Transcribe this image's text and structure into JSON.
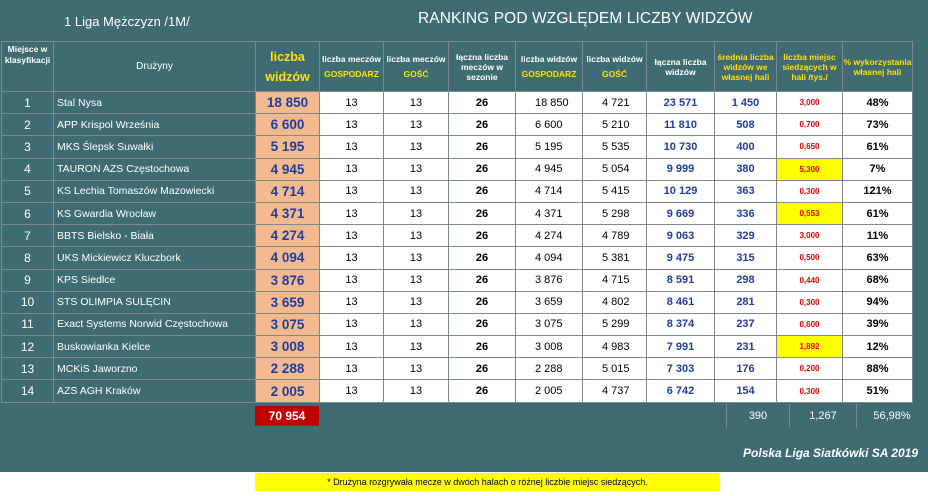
{
  "league": "1 Liga Mężczyzn /1M/",
  "title": "RANKING POD WZGLĘDEM LICZBY WIDZÓW",
  "headers": {
    "place": "Miejsce w klasyfikacji",
    "team": "Drużyny",
    "viewers_1": "liczba",
    "viewers_2": "widzów",
    "home_matches": "liczba meczów",
    "home_sub": "GOSPODARZ",
    "away_matches": "liczba meczów",
    "away_sub": "GOŚĆ",
    "total_matches": "łączna liczba meczów w sezonie",
    "home_viewers": "liczba widzów",
    "home_viewers_sub": "GOSPODARZ",
    "away_viewers": "liczba widzów",
    "away_viewers_sub": "GOŚĆ",
    "total_viewers": "łączna liczba widzów",
    "avg_viewers": "średnia liczba widzów we własnej hali",
    "seats": "liczba miejsc siedzących w hali /tys./",
    "usage": "% wykorzystania własnej hali"
  },
  "rows": [
    {
      "pos": "1",
      "team": "Stal Nysa",
      "viewers": "18 850",
      "hm": "13",
      "am": "13",
      "tm": "26",
      "hv": "18 850",
      "av": "4 721",
      "tv": "23 571",
      "avg": "1 450",
      "seats": "3,000",
      "pct": "48%"
    },
    {
      "pos": "2",
      "team": "APP Krispol Września",
      "viewers": "6 600",
      "hm": "13",
      "am": "13",
      "tm": "26",
      "hv": "6 600",
      "av": "5 210",
      "tv": "11 810",
      "avg": "508",
      "seats": "0,700",
      "pct": "73%"
    },
    {
      "pos": "3",
      "team": "MKS Ślepsk Suwałki",
      "viewers": "5 195",
      "hm": "13",
      "am": "13",
      "tm": "26",
      "hv": "5 195",
      "av": "5 535",
      "tv": "10 730",
      "avg": "400",
      "seats": "0,650",
      "pct": "61%"
    },
    {
      "pos": "4",
      "team": "TAURON AZS Częstochowa",
      "viewers": "4 945",
      "hm": "13",
      "am": "13",
      "tm": "26",
      "hv": "4 945",
      "av": "5 054",
      "tv": "9 999",
      "avg": "380",
      "seats": "5,300",
      "pct": "7%"
    },
    {
      "pos": "5",
      "team": "KS Lechia Tomaszów Mazowiecki",
      "viewers": "4 714",
      "hm": "13",
      "am": "13",
      "tm": "26",
      "hv": "4 714",
      "av": "5 415",
      "tv": "10 129",
      "avg": "363",
      "seats": "0,300",
      "pct": "121%"
    },
    {
      "pos": "6",
      "team": "KS Gwardia Wrocław",
      "viewers": "4 371",
      "hm": "13",
      "am": "13",
      "tm": "26",
      "hv": "4 371",
      "av": "5 298",
      "tv": "9 669",
      "avg": "336",
      "seats": "0,553",
      "pct": "61%"
    },
    {
      "pos": "7",
      "team": "BBTS Bielsko - Biała",
      "viewers": "4 274",
      "hm": "13",
      "am": "13",
      "tm": "26",
      "hv": "4 274",
      "av": "4 789",
      "tv": "9 063",
      "avg": "329",
      "seats": "3,000",
      "pct": "11%"
    },
    {
      "pos": "8",
      "team": "UKS Mickiewicz Kluczbork",
      "viewers": "4 094",
      "hm": "13",
      "am": "13",
      "tm": "26",
      "hv": "4 094",
      "av": "5 381",
      "tv": "9 475",
      "avg": "315",
      "seats": "0,500",
      "pct": "63%"
    },
    {
      "pos": "9",
      "team": "KPS Siedlce",
      "viewers": "3 876",
      "hm": "13",
      "am": "13",
      "tm": "26",
      "hv": "3 876",
      "av": "4 715",
      "tv": "8 591",
      "avg": "298",
      "seats": "0,440",
      "pct": "68%"
    },
    {
      "pos": "10",
      "team": "STS OLIMPIA SULĘCIN",
      "viewers": "3 659",
      "hm": "13",
      "am": "13",
      "tm": "26",
      "hv": "3 659",
      "av": "4 802",
      "tv": "8 461",
      "avg": "281",
      "seats": "0,300",
      "pct": "94%"
    },
    {
      "pos": "11",
      "team": "Exact Systems Norwid Częstochowa",
      "viewers": "3 075",
      "hm": "13",
      "am": "13",
      "tm": "26",
      "hv": "3 075",
      "av": "5 299",
      "tv": "8 374",
      "avg": "237",
      "seats": "0,600",
      "pct": "39%"
    },
    {
      "pos": "12",
      "team": "Buskowianka Kielce",
      "viewers": "3 008",
      "hm": "13",
      "am": "13",
      "tm": "26",
      "hv": "3 008",
      "av": "4 983",
      "tv": "7 991",
      "avg": "231",
      "seats": "1,892",
      "pct": "12%"
    },
    {
      "pos": "13",
      "team": "MCKiS Jaworzno",
      "viewers": "2 288",
      "hm": "13",
      "am": "13",
      "tm": "26",
      "hv": "2 288",
      "av": "5 015",
      "tv": "7 303",
      "avg": "176",
      "seats": "0,200",
      "pct": "88%"
    },
    {
      "pos": "14",
      "team": "AZS AGH Kraków",
      "viewers": "2 005",
      "hm": "13",
      "am": "13",
      "tm": "26",
      "hv": "2 005",
      "av": "4 737",
      "tv": "6 742",
      "avg": "154",
      "seats": "0,300",
      "pct": "51%"
    }
  ],
  "totals": {
    "viewers": "70 954",
    "avg": "390",
    "seats": "1,267",
    "pct": "56,98%"
  },
  "brand": "Polska Liga Siatkówki SA 2019",
  "note": "* Drużyna rozgrywała mecze w dwóch halach o różnej liczbie miejsc siedzących.",
  "colors": {
    "frame": "#3f6b73",
    "viewers_bg": "#f4ba8f",
    "highlight": "#ffff00",
    "total_bg": "#c00000"
  }
}
